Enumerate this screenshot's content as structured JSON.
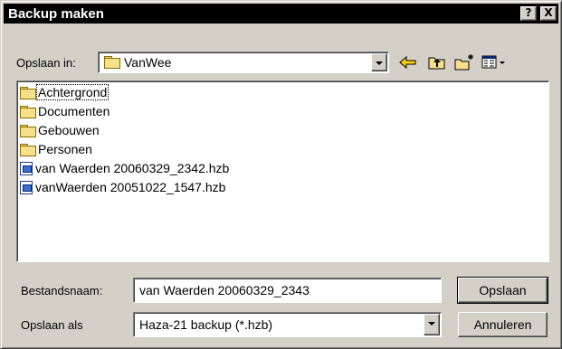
{
  "window": {
    "title": "Backup maken",
    "help_label": "?",
    "close_label": "X"
  },
  "location": {
    "label": "Opslaan in:",
    "value": "VanWee"
  },
  "files": [
    {
      "name": "Achtergrond",
      "type": "folder",
      "focused": true
    },
    {
      "name": "Documenten",
      "type": "folder"
    },
    {
      "name": "Gebouwen",
      "type": "folder"
    },
    {
      "name": "Personen",
      "type": "folder"
    },
    {
      "name": "van Waerden 20060329_2342.hzb",
      "type": "file"
    },
    {
      "name": "vanWaerden 20051022_1547.hzb",
      "type": "file"
    }
  ],
  "filename": {
    "label": "Bestandsnaam:",
    "value": "van Waerden 20060329_2343"
  },
  "filetype": {
    "label": "Opslaan als",
    "value": "Haza-21 backup (*.hzb)"
  },
  "buttons": {
    "save": "Opslaan",
    "cancel": "Annuleren"
  },
  "colors": {
    "titlebar": "#000000",
    "face": "#d4d0c8",
    "folder": "#f7e08a"
  }
}
